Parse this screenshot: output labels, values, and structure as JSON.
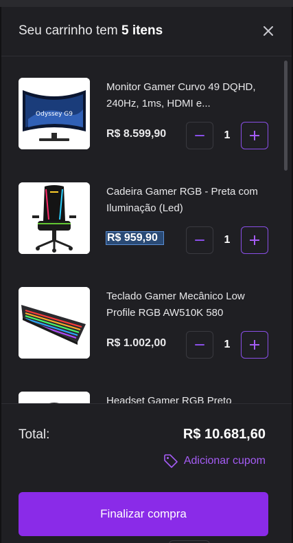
{
  "cart": {
    "title_prefix": "Seu carrinho tem",
    "title_count": "5 itens",
    "close_icon": "close-icon"
  },
  "items": [
    {
      "name": "Monitor Gamer Curvo 49 DQHD, 240Hz, 1ms, HDMI e...",
      "price": "R$ 8.599,90",
      "qty": "1",
      "image": "monitor-image",
      "screen_text": "Odyssey G9"
    },
    {
      "name": "Cadeira Gamer  RGB - Preta com Iluminação (Led)",
      "price": "R$ 959,90",
      "qty": "1",
      "image": "chair-image"
    },
    {
      "name": "Teclado Gamer Mecânico Low Profile RGB AW510K 580",
      "price": "R$ 1.002,00",
      "qty": "1",
      "image": "keyboard-image"
    },
    {
      "name": "Headset Gamer RGB Preto",
      "price": "",
      "qty": "",
      "image": "headset-image"
    }
  ],
  "footer": {
    "total_label": "Total:",
    "total_value": "R$ 10.681,60",
    "coupon_label": "Adicionar cupom",
    "checkout_label": "Finalizar compra"
  },
  "colors": {
    "background": "#1f1f23",
    "accent": "#8a2be8",
    "accent_text": "#a55cf5"
  }
}
